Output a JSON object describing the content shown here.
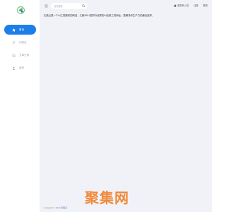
{
  "sidebar": {
    "logo_icon": "leaf-logo-icon",
    "items": [
      {
        "label": "首页",
        "icon": "home-icon",
        "active": true
      },
      {
        "label": "问答区",
        "icon": "paperclip-icon",
        "active": false
      },
      {
        "label": "文章分类",
        "icon": "document-icon",
        "active": false
      },
      {
        "label": "我的",
        "icon": "user-icon",
        "active": false
      }
    ]
  },
  "topbar": {
    "menu_icon": "menu-icon",
    "search_placeholder": "站内搜索",
    "links": {
      "apply": "服务商入驻",
      "register": "注册",
      "login": "登录"
    }
  },
  "main": {
    "intro": "无极云是一个AI工具服务的网站，汇聚500+国内外优秀的AI应用工具网址，是解决你生产力的最优选择。"
  },
  "brand": {
    "text": "聚集网"
  },
  "footer": {
    "copyright": "Copyright © 2023",
    "link": "无极云"
  },
  "colors": {
    "accent": "#1e7ee8",
    "main_bg": "#f1f2f7",
    "brand": "#f08a3c"
  }
}
